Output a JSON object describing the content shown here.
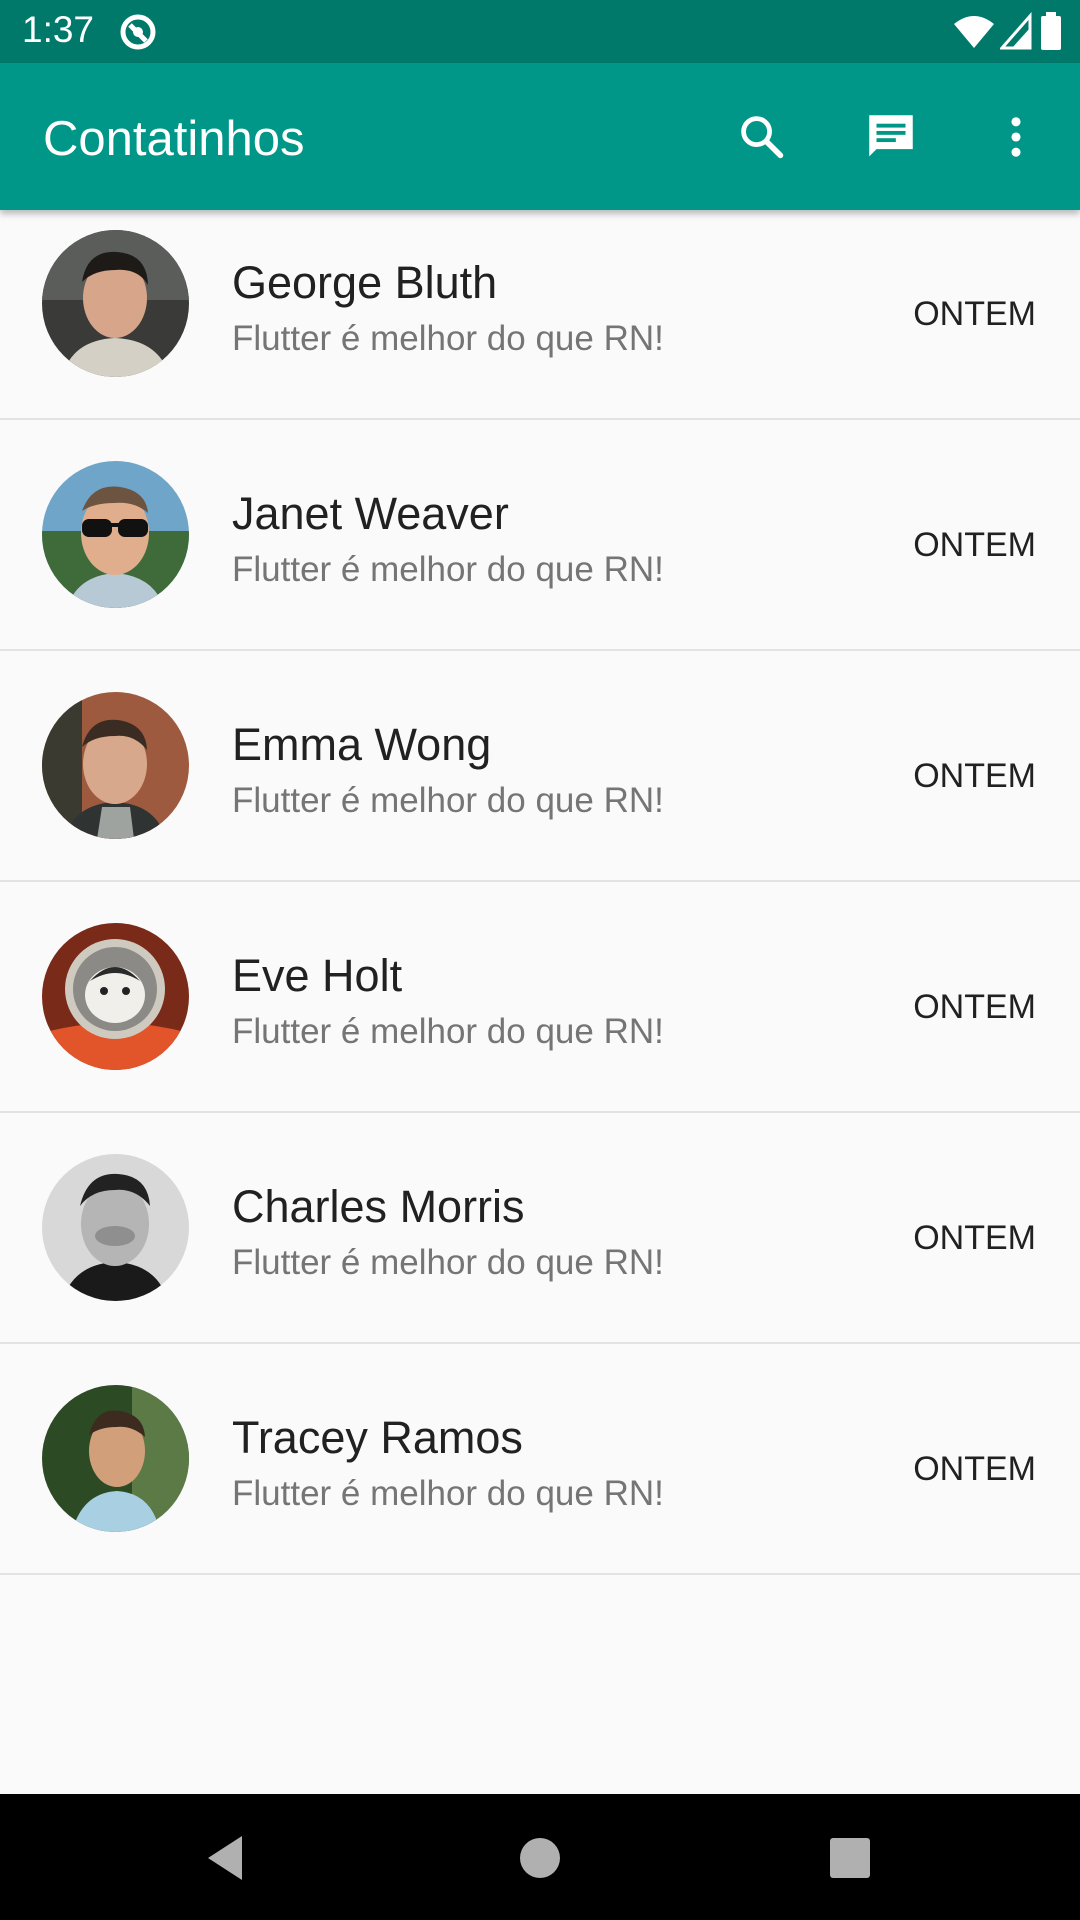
{
  "status_bar": {
    "time": "1:37"
  },
  "app_bar": {
    "title": "Contatinhos"
  },
  "contacts": [
    {
      "name": "George Bluth",
      "message": "Flutter é melhor do que RN!",
      "time": "ONTEM"
    },
    {
      "name": "Janet Weaver",
      "message": "Flutter é melhor do que RN!",
      "time": "ONTEM"
    },
    {
      "name": "Emma Wong",
      "message": "Flutter é melhor do que RN!",
      "time": "ONTEM"
    },
    {
      "name": "Eve Holt",
      "message": "Flutter é melhor do que RN!",
      "time": "ONTEM"
    },
    {
      "name": "Charles Morris",
      "message": "Flutter é melhor do que RN!",
      "time": "ONTEM"
    },
    {
      "name": "Tracey Ramos",
      "message": "Flutter é melhor do que RN!",
      "time": "ONTEM"
    }
  ],
  "colors": {
    "status_bar": "#00796b",
    "app_bar": "#009688",
    "background": "#fafafa"
  },
  "icons": {
    "app_bar_actions": [
      "search-icon",
      "chat-icon",
      "more-vert-icon"
    ],
    "nav": [
      "back-icon",
      "home-icon",
      "recents-icon"
    ]
  }
}
